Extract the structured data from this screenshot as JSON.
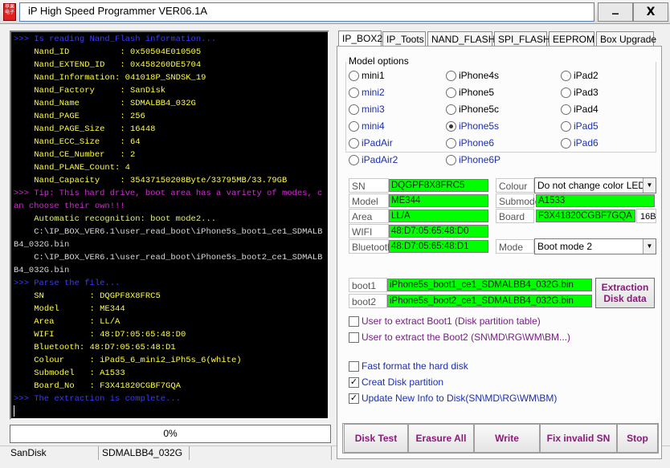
{
  "window": {
    "title": "iP High Speed Programmer VER06.1A",
    "minimize_label": "_",
    "close_label": "X",
    "icon_text": "苹果电子"
  },
  "console": {
    "lines": [
      {
        "text": ">>> Is reading Nand_Flash information...",
        "color": "blue"
      },
      {
        "text": "    Nand_ID          : 0x50504E010505",
        "color": "yellow"
      },
      {
        "text": "    Nand_EXTEND_ID   : 0x458260DE5704",
        "color": "yellow"
      },
      {
        "text": "    Nand_Information: 041018P_SNDSK_19",
        "color": "yellow"
      },
      {
        "text": "    Nand_Factory     : SanDisk",
        "color": "yellow"
      },
      {
        "text": "    Nand_Name        : SDMALBB4_032G",
        "color": "yellow"
      },
      {
        "text": "    Nand_PAGE        : 256",
        "color": "yellow"
      },
      {
        "text": "    Nand_PAGE_Size   : 16448",
        "color": "yellow"
      },
      {
        "text": "    Nand_ECC_Size    : 64",
        "color": "yellow"
      },
      {
        "text": "    Nand_CE_Number   : 2",
        "color": "yellow"
      },
      {
        "text": "    Nand_PLANE_Count: 4",
        "color": "yellow"
      },
      {
        "text": "    Nand_Capacity    : 35437150208Byte/33795MB/33.79GB",
        "color": "yellow"
      },
      {
        "text": ">>> Tip: This hard drive, boot area has a variety of modes, can choose their own!!!",
        "color": "magenta"
      },
      {
        "text": "    Automatic recognition: boot mode2...",
        "color": "green"
      },
      {
        "text": "    C:\\IP_BOX_VER6.1\\user_read_boot\\iPhone5s_boot1_ce1_SDMALBB4_032G.bin",
        "color": "gray"
      },
      {
        "text": "    C:\\IP_BOX_VER6.1\\user_read_boot\\iPhone5s_boot2_ce1_SDMALBB4_032G.bin",
        "color": "gray"
      },
      {
        "text": ">>> Parse the file...",
        "color": "blue"
      },
      {
        "text": "    SN         : DQGPF8X8FRC5",
        "color": "yellow"
      },
      {
        "text": "    Model      : ME344",
        "color": "yellow"
      },
      {
        "text": "    Area       : LL/A",
        "color": "yellow"
      },
      {
        "text": "    WIFI       : 48:D7:05:65:48:D0",
        "color": "yellow"
      },
      {
        "text": "    Bluetooth: 48:D7:05:65:48:D1",
        "color": "yellow"
      },
      {
        "text": "    Colour     : iPad5_6_mini2_iPh5s_6(white)",
        "color": "yellow"
      },
      {
        "text": "    Submodel   : A1533",
        "color": "yellow"
      },
      {
        "text": "    Board_No   : F3X41820CGBF7GQA",
        "color": "yellow"
      },
      {
        "text": ">>> The extraction is complete...",
        "color": "blue"
      }
    ]
  },
  "progress": {
    "label": "0%",
    "value": 0
  },
  "status_bar": {
    "factory": "SanDisk",
    "name": "SDMALBB4_032G"
  },
  "tabs": [
    "IP_BOX2",
    "IP_Toots",
    "NAND_FLASH",
    "SPI_FLASH",
    "EEPROM",
    "Box Upgrade"
  ],
  "active_tab": "IP_BOX2",
  "model_options": {
    "label": "Model options",
    "selected": "iPhone5s",
    "columns": [
      [
        "mini1",
        "mini2",
        "mini3",
        "mini4",
        "iPadAir",
        "iPadAir2"
      ],
      [
        "iPhone4s",
        "iPhone5",
        "iPhone5c",
        "iPhone5s",
        "iPhone6",
        "iPhone6P"
      ],
      [
        "iPad2",
        "iPad3",
        "iPad4",
        "iPad5",
        "iPad6"
      ]
    ],
    "blue_items": [
      "mini2",
      "mini3",
      "mini4",
      "iPadAir",
      "iPadAir2",
      "iPhone5s",
      "iPhone6",
      "iPhone6P",
      "iPad5",
      "iPad6"
    ]
  },
  "fields": {
    "sn": {
      "label": "SN",
      "value": "DQGPF8X8FRC5"
    },
    "model": {
      "label": "Model",
      "value": "ME344"
    },
    "area": {
      "label": "Area",
      "value": "LL/A"
    },
    "wifi": {
      "label": "WIFI",
      "value": "48:D7:05:65:48:D0"
    },
    "bluetooth": {
      "label": "Bluetooth",
      "value": "48:D7:05:65:48:D1"
    },
    "colour": {
      "label": "Colour",
      "value": "Do not change color LED"
    },
    "submodel": {
      "label": "Submodel",
      "value": "A1533"
    },
    "board": {
      "label": "Board",
      "value": "F3X41820CGBF7GQA",
      "suffix": "16B"
    },
    "mode": {
      "label": "Mode",
      "value": "Boot mode 2"
    },
    "boot1": {
      "label": "boot1",
      "value": "iPhone5s_boot1_ce1_SDMALBB4_032G.bin"
    },
    "boot2": {
      "label": "boot2",
      "value": "iPhone5s_boot2_ce1_SDMALBB4_032G.bin"
    }
  },
  "extraction_button": {
    "line1": "Extraction",
    "line2": "Disk data"
  },
  "checkboxes": {
    "extract_boot1": {
      "label": "User to extract Boot1 (Disk partition table)",
      "checked": false
    },
    "extract_boot2": {
      "label": "User to extract the Boot2 (SN\\MD\\RG\\WM\\BM...)",
      "checked": false
    },
    "fast_format": {
      "label": "Fast format the hard disk",
      "checked": false
    },
    "create_partition": {
      "label": "Creat Disk partition",
      "checked": true
    },
    "update_info": {
      "label": "Update New Info to Disk(SN\\MD\\RG\\WM\\BM)",
      "checked": true
    }
  },
  "actions": {
    "disk_test": "Disk Test",
    "erasure_all": "Erasure All",
    "write": "Write",
    "fix_invalid_sn": "Fix invalid SN",
    "stop": "Stop"
  },
  "colors": {
    "field_green": "#00ff00",
    "action_text": "#8a1a7a",
    "console_bg": "#000000"
  }
}
